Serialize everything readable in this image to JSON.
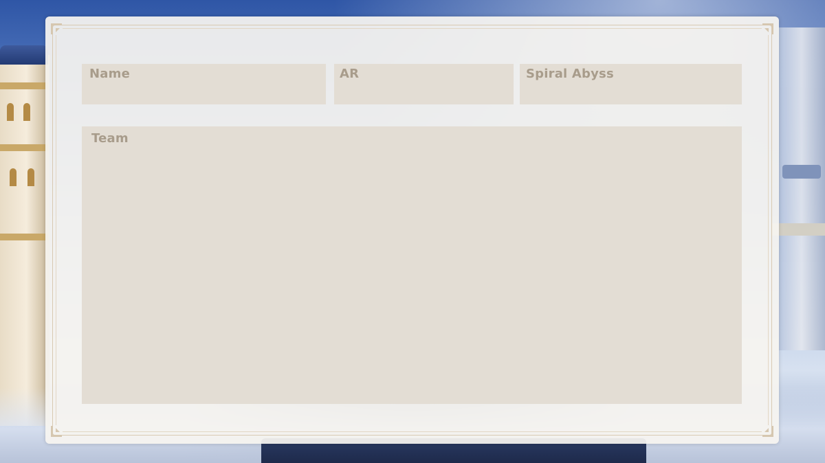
{
  "form": {
    "name_label": "Name",
    "ar_label": "AR",
    "spiral_abyss_label": "Spiral Abyss",
    "team_label": "Team"
  },
  "colors": {
    "panel_background": "#f6f4f0",
    "field_background": "#e3ddd4",
    "label_text": "#a89c8b",
    "frame_border": "#d8c9b2"
  },
  "icons": {
    "frame_corners": "corner-ornament-icon"
  }
}
